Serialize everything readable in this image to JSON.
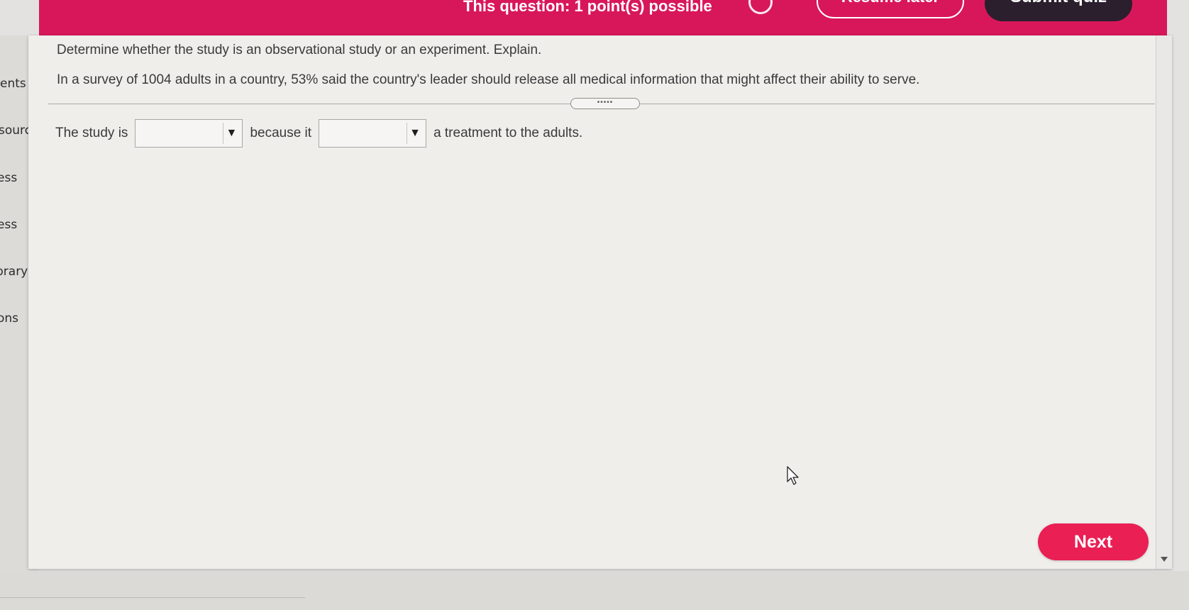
{
  "header": {
    "title": "This question: 1 point(s) possible",
    "resume_label": "Resume later",
    "submit_label": "Submit quiz"
  },
  "sidebar": {
    "items": [
      {
        "label": "ents"
      },
      {
        "label": "sourc"
      },
      {
        "label": "ess"
      },
      {
        "label": "ess"
      },
      {
        "label": "brary"
      },
      {
        "label": "ons"
      }
    ]
  },
  "question": {
    "instruction": "Determine whether the study is an observational study or an experiment. Explain.",
    "problem": "In a survey of 1004 adults in a country, 53% said the country's leader should release all medical information that might affect their ability to serve.",
    "splitter_glyph": "•••••",
    "answer": {
      "prefix": "The study is",
      "dropdown1_value": "",
      "middle": "because it",
      "dropdown2_value": "",
      "suffix": "a treatment to the adults."
    }
  },
  "footer": {
    "next_label": "Next"
  },
  "icons": {
    "dropdown_arrow": "▼"
  },
  "colors": {
    "header_bg": "#d8175a",
    "next_bg": "#ea1f54",
    "submit_bg": "#2b1f2e"
  }
}
